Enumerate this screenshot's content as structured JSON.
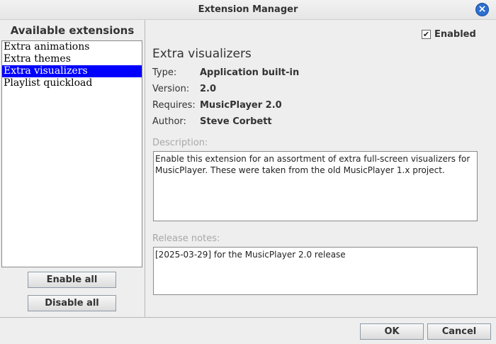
{
  "window": {
    "title": "Extension Manager",
    "close_symbol": "×"
  },
  "sidebar": {
    "heading": "Available extensions",
    "items": [
      {
        "label": "Extra animations",
        "selected": false
      },
      {
        "label": "Extra themes",
        "selected": false
      },
      {
        "label": "Extra visualizers",
        "selected": true
      },
      {
        "label": "Playlist quickload",
        "selected": false
      }
    ],
    "enable_all_label": "Enable all",
    "disable_all_label": "Disable all"
  },
  "details": {
    "enabled_checked": true,
    "enabled_check_glyph": "✔",
    "enabled_label": "Enabled",
    "title": "Extra visualizers",
    "fields": [
      {
        "key": "Type:",
        "value": "Application built-in"
      },
      {
        "key": "Version:",
        "value": "2.0"
      },
      {
        "key": "Requires:",
        "value": "MusicPlayer 2.0"
      },
      {
        "key": "Author:",
        "value": "Steve Corbett"
      }
    ],
    "description_label": "Description:",
    "description_text": "Enable this extension for an assortment of extra full-screen visualizers for MusicPlayer. These were taken from the old MusicPlayer 1.x project.",
    "release_notes_label": "Release notes:",
    "release_notes_text": "[2025-03-29] for the MusicPlayer 2.0 release"
  },
  "footer": {
    "ok_label": "OK",
    "cancel_label": "Cancel"
  },
  "colors": {
    "selection": "#0000ff",
    "close_button": "#2c6fd1",
    "background": "#eeeeee"
  }
}
